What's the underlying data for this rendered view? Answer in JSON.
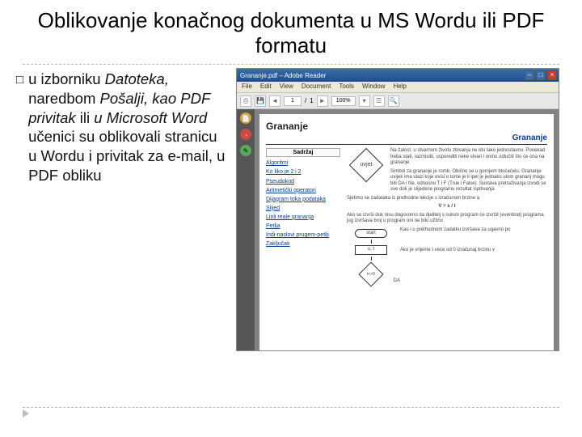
{
  "title": "Oblikovanje konačnog dokumenta u MS Wordu ili PDF formatu",
  "bullet": {
    "marker": "□",
    "text_plain1": "u izborniku ",
    "text_em1": "Datoteka,",
    "text_plain2": " naredbom ",
    "text_em2": "Pošalji, kao PDF privitak",
    "text_plain3": " ili ",
    "text_em3": "u Microsoft Word",
    "text_plain4": " učenici su oblikovali stranicu u Wordu i privitak za e-mail, u PDF obliku"
  },
  "reader": {
    "window_title": "Grananje.pdf – Adobe Reader",
    "menu": [
      "File",
      "Edit",
      "View",
      "Document",
      "Tools",
      "Window",
      "Help"
    ],
    "toolbar": {
      "page_current": "1",
      "page_sep": "/",
      "page_total": "1",
      "zoom": "100%"
    },
    "sidebar_icons": [
      "page-icon",
      "bookmark-icon",
      "signature-icon"
    ],
    "paper": {
      "heading": "Grananje",
      "heading_right": "Grananje",
      "toc_title": "Sadržaj",
      "toc": [
        "Algoritmi",
        "Ko liko je 2 i 2",
        "Pseudokod",
        "Aritmetički operatori",
        "Dijagram toka podataka",
        "Slijed",
        "Linli reale grananja",
        "Petlja",
        "Indi-naslovi prugem-petlji",
        "Zaključak"
      ],
      "para1": "Na žalost, u stvarnom životu zbivanja ne idu tako jednostavno. Ponekad treba stati, razmisliti, usporediti neke stvari i onino odlučiti što će ona na grananje",
      "diamond": "uvjet",
      "para2": "Simbol za grananje je romb. Obično se u gornjem bloćaćelu. Grananje uvijek ima ulazi koje ovisi o tome je li ipel je jednako ulom grananj mogu biti DA i Ne, odnosno T i F (True i False). Sustava pretraživanja izvodi se sve dok je slijedeće programu rezultat ispitivanja",
      "para3": "Sjetimo se zadataka iz prethodne lekcije s izračunom brzine a",
      "formula": "V = s / t",
      "para4": "Ako se izvrši dok nisu dogovorno da djelitelj s nulom program će izvršit (eventirat) programa jug izvršava broj u program oni ne bilo užitno",
      "flow_start": "start",
      "flow_rect": "s, t",
      "para5": "Kao i u prethodnom zadatku izvršava za ugavno po",
      "diamond2": "t<>0",
      "da": "DA",
      "para6": "Ako je vrijeme t veće od 0 izračunaj brzinu v"
    }
  }
}
